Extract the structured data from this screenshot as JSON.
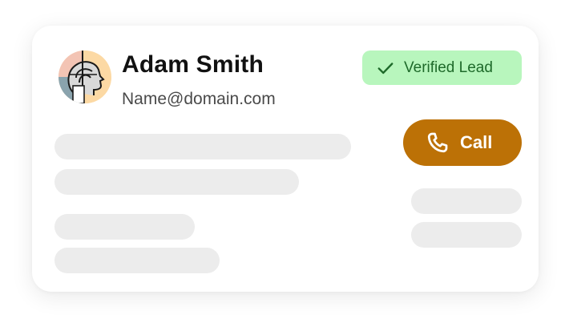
{
  "contact": {
    "name": "Adam Smith",
    "email": "Name@domain.com"
  },
  "badge": {
    "label": "Verified Lead",
    "icon": "check-icon",
    "color": "#b8f6bd"
  },
  "call_button": {
    "label": "Call",
    "icon": "phone-icon",
    "color": "#bc7106"
  },
  "avatar": {
    "icon": "profile-head-illustration"
  }
}
